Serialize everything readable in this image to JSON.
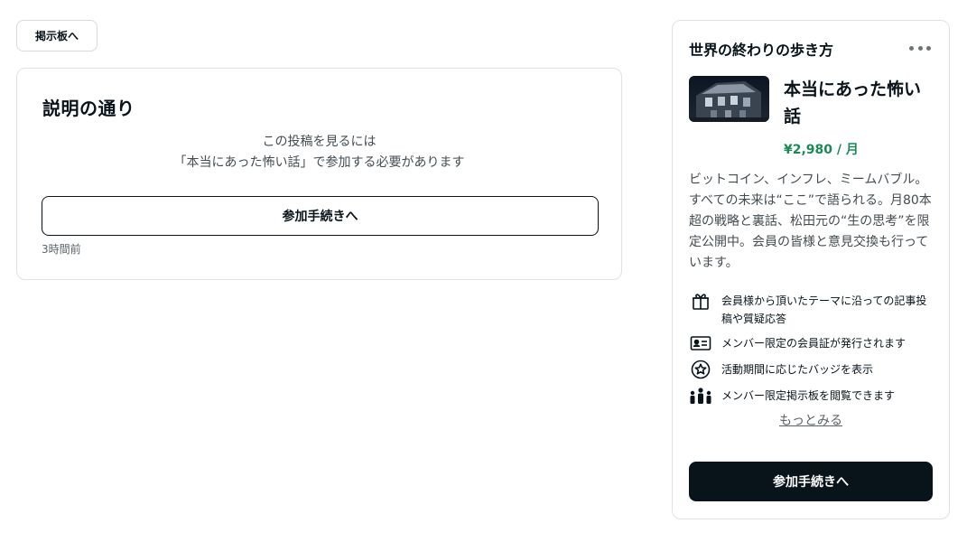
{
  "nav": {
    "back_to_board_label": "掲示板へ"
  },
  "post": {
    "title": "説明の通り",
    "message_line1": "この投稿を見るには",
    "message_line2": "「本当にあった怖い話」で参加する必要があります",
    "join_label": "参加手続きへ",
    "time": "3時間前"
  },
  "membership": {
    "creator_name": "世界の終わりの歩き方",
    "plan_name": "本当にあった怖い話",
    "price": "¥2,980 / 月",
    "description": "ビットコイン、インフレ、ミームバブル。すべての未来は“ここ”で語られる。月80本超の戦略と裏話、松田元の“生の思考”を限定公開中。会員の皆様と意見交換も行っています。",
    "benefits": [
      {
        "icon": "gift-icon",
        "text": "会員様から頂いたテーマに沿っての記事投稿や質疑応答"
      },
      {
        "icon": "member-card-icon",
        "text": "メンバー限定の会員証が発行されます"
      },
      {
        "icon": "badge-star-icon",
        "text": "活動期間に応じたバッジを表示"
      },
      {
        "icon": "people-icon",
        "text": "メンバー限定掲示板を閲覧できます"
      }
    ],
    "more_link": "もっとみる",
    "join_label": "参加手続きへ"
  },
  "colors": {
    "text": "#08131a",
    "price": "#1a8a55",
    "border": "#dfe2e4",
    "button_dark": "#08131a"
  }
}
